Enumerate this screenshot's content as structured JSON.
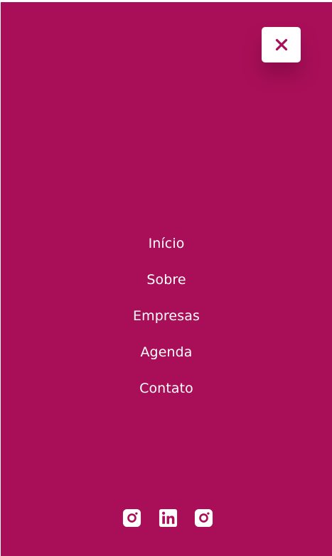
{
  "colors": {
    "menu_background": "#a90f58",
    "close_background": "#ffffff",
    "close_icon": "#a90f58",
    "text": "#ffffff"
  },
  "close_button": {
    "icon": "close-icon"
  },
  "nav": {
    "items": [
      {
        "label": "Início"
      },
      {
        "label": "Sobre"
      },
      {
        "label": "Empresas"
      },
      {
        "label": "Agenda"
      },
      {
        "label": "Contato"
      }
    ]
  },
  "social": {
    "icons": [
      "instagram-icon",
      "linkedin-icon",
      "instagram-icon"
    ]
  }
}
